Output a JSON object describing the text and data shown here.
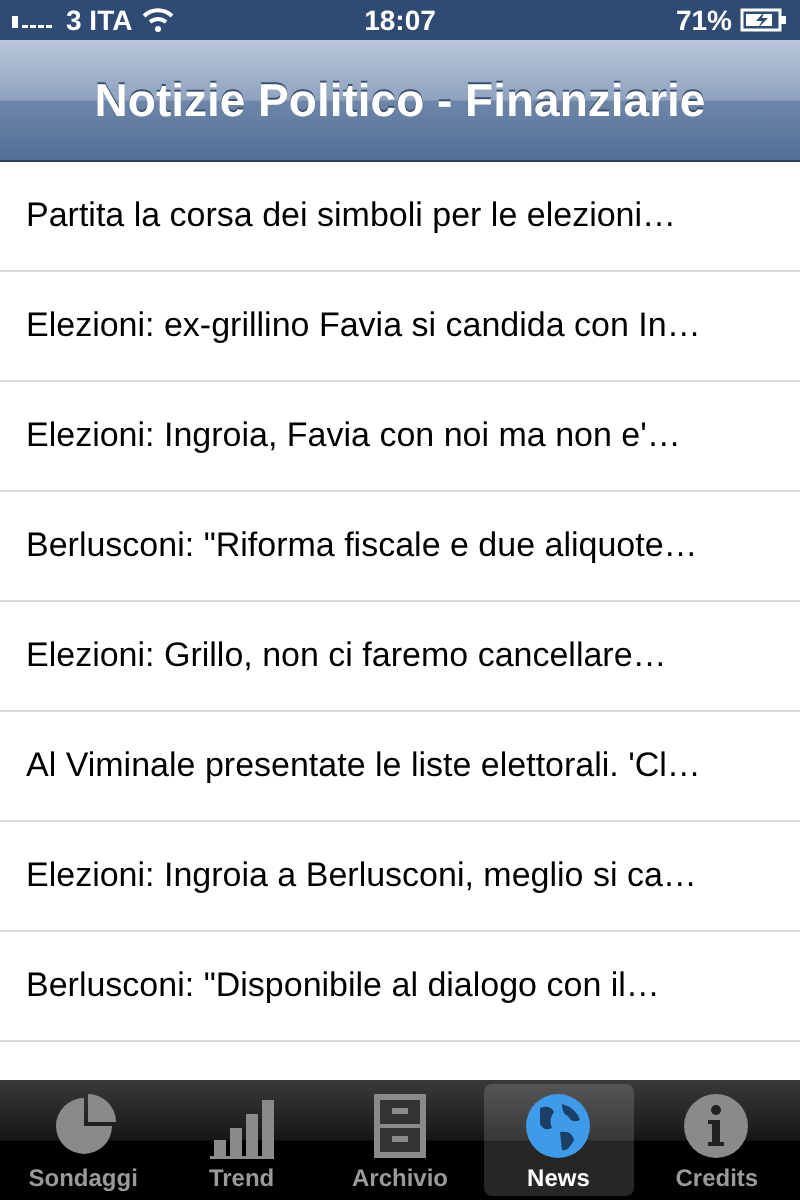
{
  "status_bar": {
    "carrier": "3 ITA",
    "time": "18:07",
    "battery": "71%"
  },
  "nav_bar": {
    "title": "Notizie Politico - Finanziarie"
  },
  "news": [
    {
      "title": "Partita la corsa dei simboli per le elezioni…"
    },
    {
      "title": "Elezioni: ex-grillino Favia si candida con In…"
    },
    {
      "title": "Elezioni: Ingroia, Favia con noi ma non e'…"
    },
    {
      "title": "Berlusconi: \"Riforma fiscale e due aliquote…"
    },
    {
      "title": "Elezioni: Grillo, non ci faremo cancellare…"
    },
    {
      "title": "Al Viminale presentate le liste elettorali. 'Cl…"
    },
    {
      "title": "Elezioni: Ingroia a Berlusconi, meglio si ca…"
    },
    {
      "title": "Berlusconi: \"Disponibile al dialogo con il…"
    }
  ],
  "tab_bar": [
    {
      "label": "Sondaggi",
      "kind": "pie",
      "selected": false
    },
    {
      "label": "Trend",
      "kind": "bars",
      "selected": false
    },
    {
      "label": "Archivio",
      "kind": "cabinet",
      "selected": false
    },
    {
      "label": "News",
      "kind": "globe",
      "selected": true
    },
    {
      "label": "Credits",
      "kind": "info",
      "selected": false
    }
  ]
}
